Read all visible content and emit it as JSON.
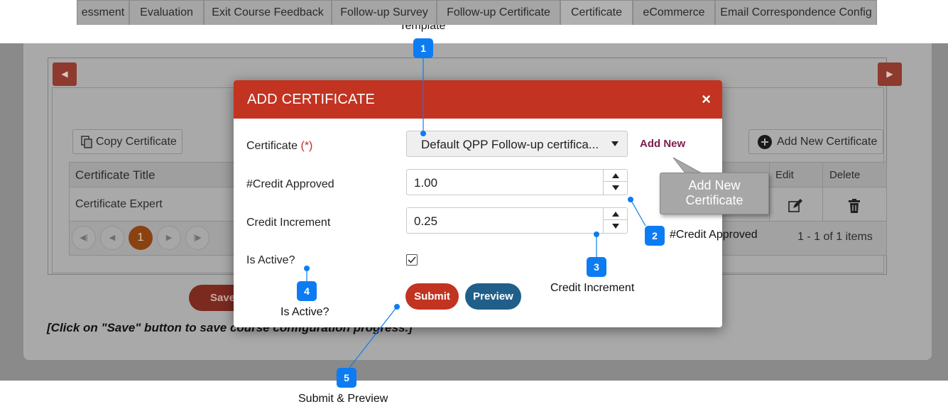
{
  "annotations": {
    "certificate_template": "Certificate\nTemplate",
    "credit_approved": "#Credit Approved",
    "credit_increment": "Credit Increment",
    "is_active": "Is Active?",
    "submit_preview": "Submit & Preview",
    "badges": [
      "1",
      "2",
      "3",
      "4",
      "5"
    ],
    "tooltip": "Add New\nCertificate"
  },
  "tabs": [
    "essment",
    "Evaluation",
    "Exit Course Feedback",
    "Follow-up Survey",
    "Follow-up Certificate",
    "Certificate",
    "eCommerce",
    "Email Correspondence Config"
  ],
  "active_tab": "Certificate",
  "background": {
    "copy_button": "Copy Certificate",
    "add_certificate_button": "Add New Certificate",
    "columns": {
      "title": "Certificate Title",
      "edit": "Edit",
      "delete": "Delete"
    },
    "row_title": "Certificate Expert",
    "pager": {
      "current_page": "1",
      "summary": "1 - 1 of 1 items"
    },
    "save_button": "Save",
    "hint": "[Click on \"Save\" button to save course configuration progress.]"
  },
  "modal": {
    "title": "ADD CERTIFICATE",
    "close": "×",
    "certificate_label": "Certificate",
    "required_mark": "(*)",
    "certificate_value": "Default QPP Follow-up certifica...",
    "add_new_link": "Add New",
    "credit_approved_label": "#Credit Approved",
    "credit_approved_value": "1.00",
    "credit_increment_label": "Credit Increment",
    "credit_increment_value": "0.25",
    "is_active_label": "Is Active?",
    "is_active_checked": true,
    "submit_label": "Submit",
    "preview_label": "Preview"
  },
  "colors": {
    "modal_header": "#c23321",
    "submit": "#c23321",
    "preview": "#1f5f8a",
    "annotation_badge": "#0d7cf2",
    "add_new_link": "#7a1e4a"
  },
  "icons": [
    "chevron-left-icon",
    "chevron-right-icon",
    "copy-icon",
    "plus-circle-icon",
    "edit-icon",
    "trash-icon",
    "first-page-icon",
    "prev-page-icon",
    "next-page-icon",
    "last-page-icon",
    "close-icon",
    "caret-down-icon",
    "checkmark-icon"
  ]
}
